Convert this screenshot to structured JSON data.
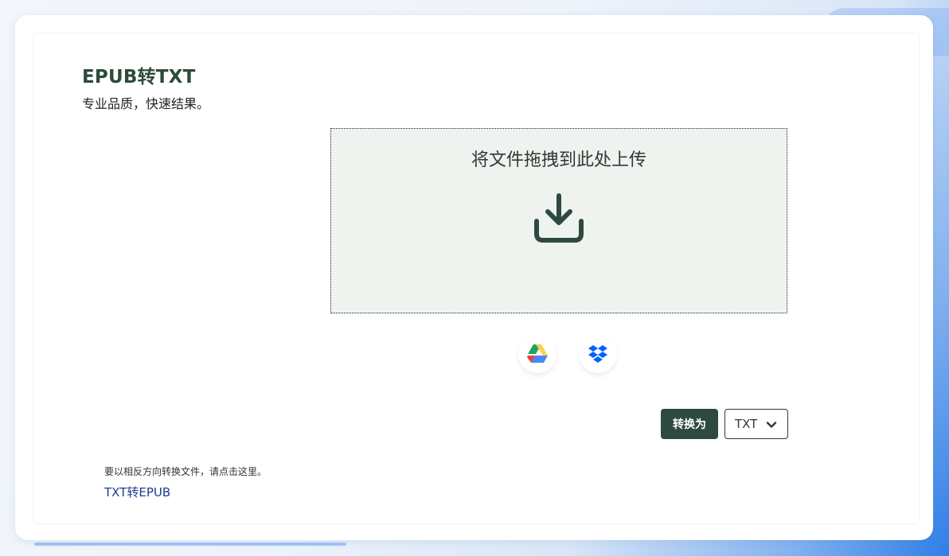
{
  "header": {
    "title": "EPUB转TXT",
    "subtitle": "专业品质，快速结果。"
  },
  "upload": {
    "drop_text": "将文件拖拽到此处上传",
    "icon": "download-tray-icon",
    "sources": [
      {
        "icon": "google-drive-icon"
      },
      {
        "icon": "dropbox-icon"
      }
    ]
  },
  "convert": {
    "button_label": "转换为",
    "selected_format": "TXT",
    "icon": "chevron-down-icon"
  },
  "reverse": {
    "note": "要以相反方向转换文件，请点击这里。",
    "link_label": "TXT转EPUB"
  },
  "colors": {
    "brand_green": "#2e4a3e",
    "dropzone_bg": "#eef3f0",
    "link": "#1f3b8f"
  }
}
